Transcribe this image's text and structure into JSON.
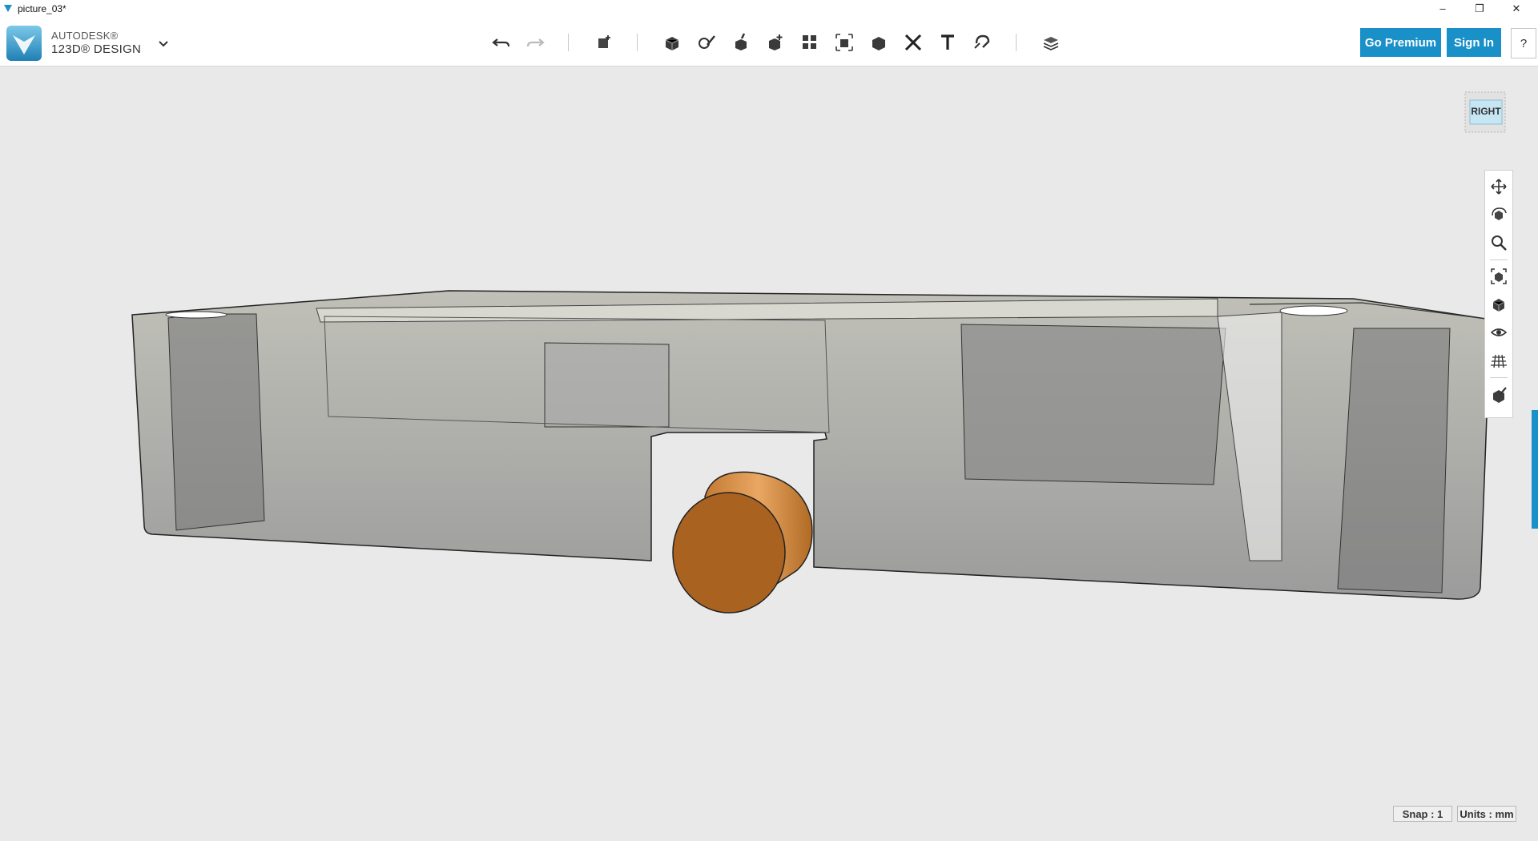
{
  "window": {
    "title": "picture_03*",
    "controls": [
      "–",
      "❐",
      "✕"
    ]
  },
  "brand": {
    "line1": "AUTODESK®",
    "line2": "123D® DESIGN",
    "menu_icon": "chevron-down-icon"
  },
  "toolbar": {
    "tools": [
      "undo-icon",
      "redo-icon",
      "transform-icon",
      "primitives-icon",
      "sketch-icon",
      "construct-icon",
      "modify-icon",
      "pattern-icon",
      "group-icon",
      "combine-icon",
      "measure-icon",
      "text-icon",
      "snap-icon",
      "materials-icon"
    ]
  },
  "account": {
    "premium_label": "Go Premium",
    "signin_label": "Sign In",
    "help_label": "?"
  },
  "viewcube": {
    "face": "RIGHT"
  },
  "navbar": {
    "tools": [
      "pan-icon",
      "orbit-icon",
      "zoom-icon",
      "fit-icon",
      "view-icon",
      "visibility-icon",
      "grid-icon",
      "material-icon"
    ]
  },
  "status": {
    "snap": "Snap : 1",
    "units": "Units : mm"
  },
  "colors": {
    "accent": "#1a90c9",
    "cylinder": "#b06a24",
    "part": "#9a9a9a"
  }
}
